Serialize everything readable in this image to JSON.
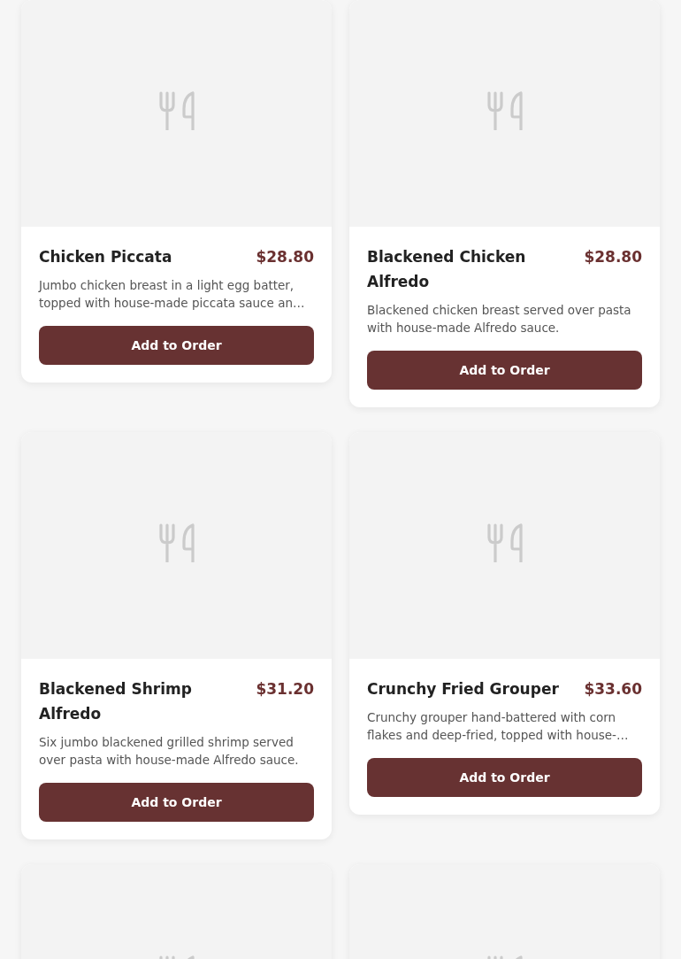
{
  "menu_items": [
    {
      "kind": "full",
      "name": "Chicken Piccata",
      "price": "$28.80",
      "description": "Jumbo chicken breast in a light egg batter, topped with house-made piccata sauce an…",
      "button": "Add to Order"
    },
    {
      "kind": "full",
      "name": "Blackened Chicken Alfredo",
      "price": "$28.80",
      "description": "Blackened chicken breast served over pasta with house-made Alfredo sauce.",
      "button": "Add to Order"
    },
    {
      "kind": "full",
      "name": "Blackened Shrimp Alfredo",
      "price": "$31.20",
      "description": "Six jumbo blackened grilled shrimp served over pasta with house-made Alfredo sauce.",
      "button": "Add to Order"
    },
    {
      "kind": "full",
      "name": "Crunchy Fried Grouper",
      "price": "$33.60",
      "description": "Crunchy grouper hand-battered with corn flakes and deep-fried, topped with house-…",
      "button": "Add to Order"
    },
    {
      "kind": "image-only"
    },
    {
      "kind": "image-only"
    }
  ]
}
